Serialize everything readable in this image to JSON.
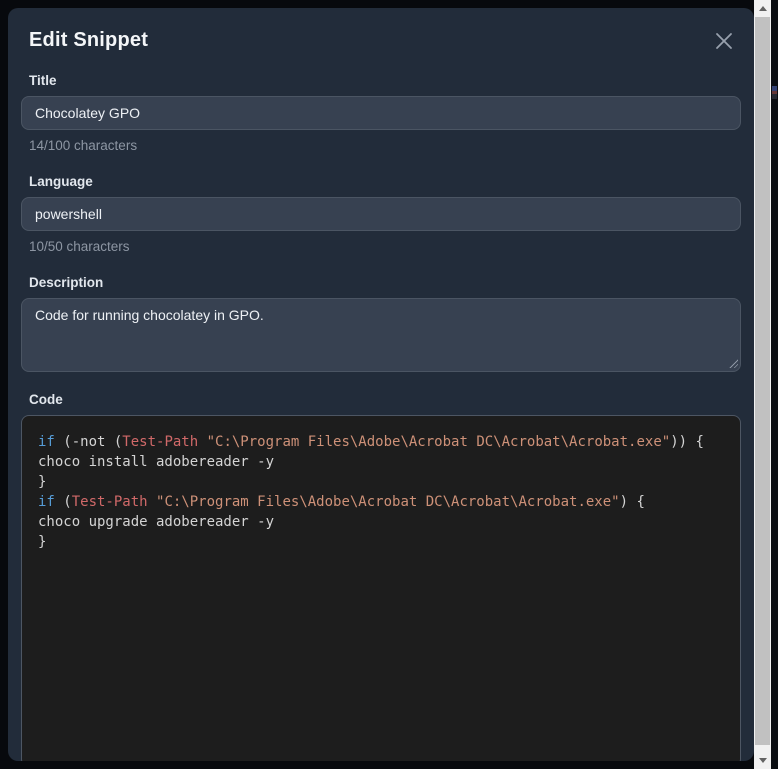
{
  "modal": {
    "title": "Edit Snippet"
  },
  "fields": {
    "title": {
      "label": "Title",
      "value": "Chocolatey GPO",
      "counter": "14/100 characters"
    },
    "language": {
      "label": "Language",
      "value": "powershell",
      "counter": "10/50 characters"
    },
    "description": {
      "label": "Description",
      "value": "Code for running chocolatey in GPO."
    },
    "code": {
      "label": "Code"
    }
  },
  "code_editor": {
    "language": "powershell",
    "token_colors": {
      "keyword": "#569cd6",
      "cmdlet": "#d16969",
      "string": "#ce9178",
      "plain": "#d4d4d4"
    },
    "lines": [
      [
        {
          "t": "if",
          "c": "keyword"
        },
        {
          "t": " (-not (",
          "c": "plain"
        },
        {
          "t": "Test-Path",
          "c": "cmdlet"
        },
        {
          "t": " ",
          "c": "plain"
        },
        {
          "t": "\"C:\\Program Files\\Adobe\\Acrobat DC\\Acrobat\\Acrobat.exe\"",
          "c": "string"
        },
        {
          "t": ")) {",
          "c": "plain"
        }
      ],
      [
        {
          "t": "choco install adobereader -y",
          "c": "plain"
        }
      ],
      [
        {
          "t": "}",
          "c": "plain"
        }
      ],
      [
        {
          "t": "if",
          "c": "keyword"
        },
        {
          "t": " (",
          "c": "plain"
        },
        {
          "t": "Test-Path",
          "c": "cmdlet"
        },
        {
          "t": " ",
          "c": "plain"
        },
        {
          "t": "\"C:\\Program Files\\Adobe\\Acrobat DC\\Acrobat\\Acrobat.exe\"",
          "c": "string"
        },
        {
          "t": ") {",
          "c": "plain"
        }
      ],
      [
        {
          "t": "choco upgrade adobereader -y",
          "c": "plain"
        }
      ],
      [
        {
          "t": "}",
          "c": "plain"
        }
      ]
    ]
  },
  "icons": {
    "close": "close-icon",
    "scroll_up": "chevron-up-icon",
    "scroll_down": "chevron-down-icon"
  },
  "colors": {
    "backdrop": "#07090d",
    "modal_bg": "#222c3a",
    "input_bg": "#374151",
    "input_border": "#4b5563",
    "code_bg": "#1d1d1d",
    "label_text": "#e2e7ed",
    "counter_text": "#8d96a3",
    "scrollbar_track": "#f1f1f1",
    "scrollbar_thumb": "#c1c1c1"
  }
}
